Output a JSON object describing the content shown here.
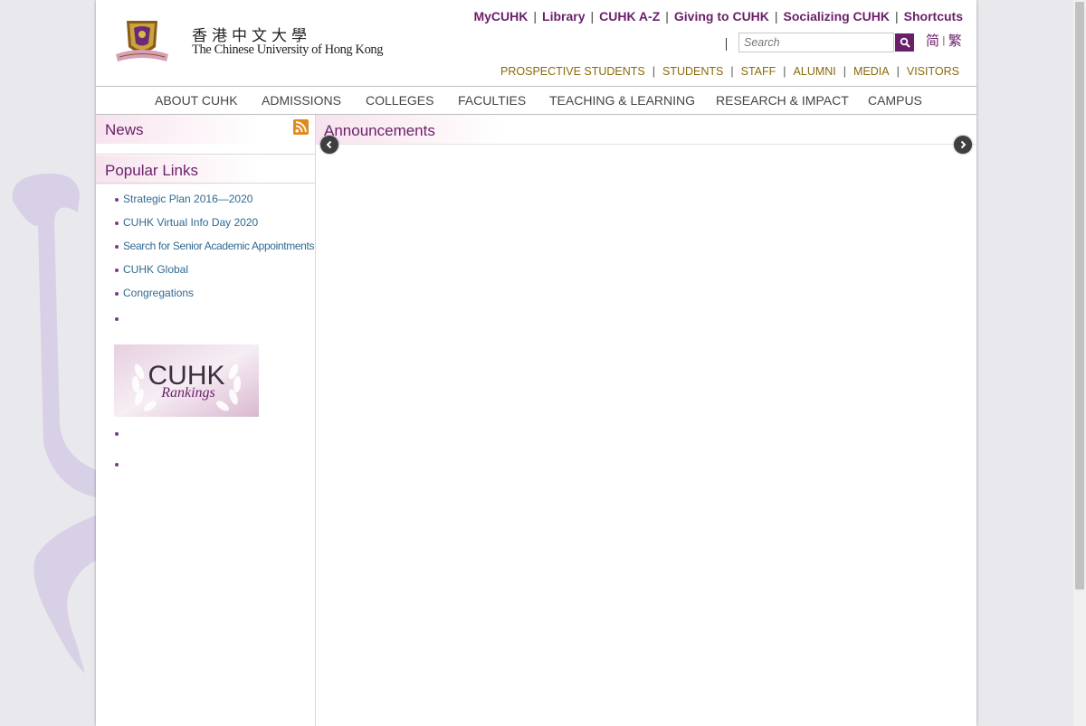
{
  "logo": {
    "cn": "香港中文大學",
    "en": "The Chinese University of Hong Kong"
  },
  "top_links": [
    "MyCUHK",
    "Library",
    "CUHK A-Z",
    "Giving to CUHK",
    "Socializing CUHK",
    "Shortcuts"
  ],
  "search": {
    "placeholder": "Search",
    "button_icon": "search-icon"
  },
  "languages": {
    "simplified": "简",
    "traditional": "繁",
    "separator": "|"
  },
  "audience_links": [
    "PROSPECTIVE STUDENTS",
    "STUDENTS",
    "STAFF",
    "ALUMNI",
    "MEDIA",
    "VISITORS"
  ],
  "main_nav": [
    "ABOUT CUHK",
    "ADMISSIONS",
    "COLLEGES",
    "FACULTIES",
    "TEACHING & LEARNING",
    "RESEARCH & IMPACT",
    "CAMPUS"
  ],
  "news": {
    "title": "News",
    "feed_icon": "rss-icon"
  },
  "popular_links": {
    "title": "Popular Links",
    "items": [
      "Strategic Plan 2016—2020",
      "CUHK Virtual Info Day 2020",
      "Search for Senior Academic Appointments",
      "CUHK Global",
      "Congregations"
    ]
  },
  "rankings_banner": {
    "word": "CUHK",
    "sub": "Rankings"
  },
  "announcements": {
    "title": "Announcements"
  },
  "colors": {
    "brand_purple": "#6a1f6a",
    "gold": "#8a6a0a",
    "link_blue": "#2e6a92"
  }
}
